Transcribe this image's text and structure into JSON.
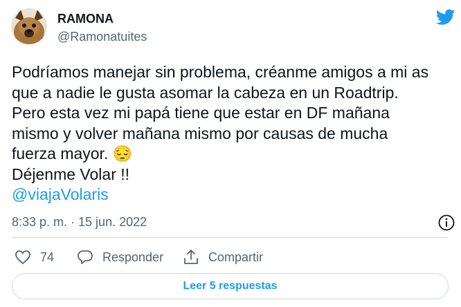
{
  "author": {
    "display_name": "RAMONA",
    "handle": "@Ramonatuites",
    "avatar_icon": "dog-avatar",
    "brand_icon": "twitter-bird-icon",
    "brand_color": "#1d9bf0"
  },
  "tweet": {
    "lines": [
      "Podríamos manejar sin problema, créanme amigos a mi as",
      "que a nadie le gusta asomar la cabeza en un Roadtrip.",
      "Pero esta vez mi papá tiene que estar en DF mañana",
      "mismo y volver mañana mismo por causas de mucha",
      "fuerza mayor.",
      "Déjenme Volar !!"
    ],
    "emoji": "😔",
    "mention": "@viajaVolaris",
    "timestamp": "8:33 p. m. · 15 jun. 2022"
  },
  "actions": {
    "likes_count": "74",
    "reply_label": "Responder",
    "share_label": "Compartir"
  },
  "replies_button_label": "Leer 5 respuestas"
}
